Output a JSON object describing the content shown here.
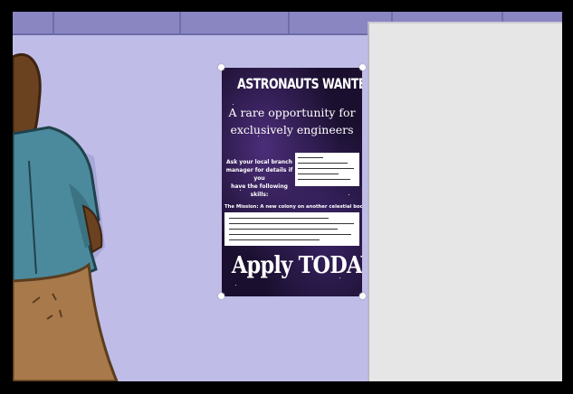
{
  "poster": {
    "title": "ASTRONAUTS WANTED!",
    "subtitle_line1": "A rare opportunity for",
    "subtitle_line2": "exclusively engineers",
    "details_line1": "Ask your local branch",
    "details_line2": "manager for details if you",
    "details_line3": "have the following skills:",
    "mission": "The Mission: A new colony on another celestial body",
    "cta": "Apply TODAY!"
  },
  "colors": {
    "wall": "#bfbde8",
    "ceiling": "#8a86c2",
    "panel": "#e6e6e6",
    "frame": "#000000",
    "shirt": "#4a8a9c",
    "pants": "#a8794a",
    "hair": "#6b4220"
  }
}
